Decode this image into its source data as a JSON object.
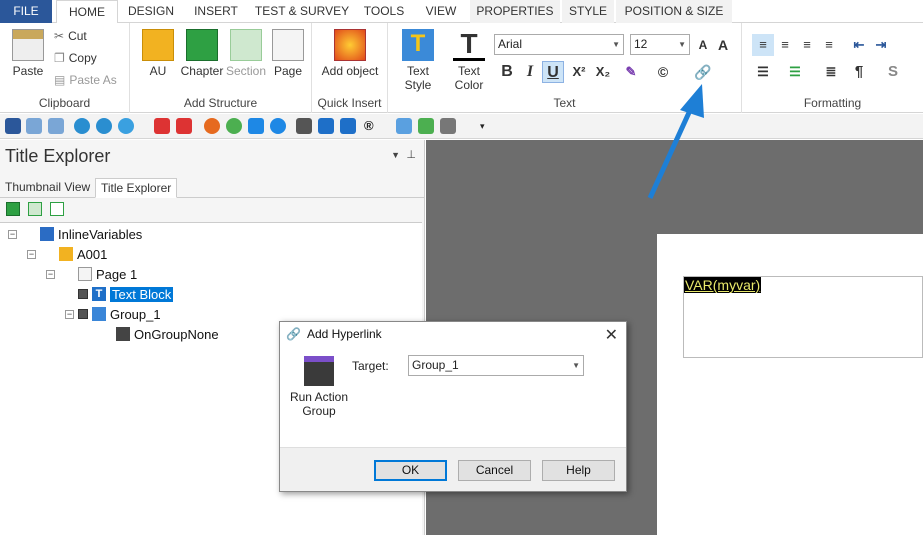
{
  "tabs": [
    "FILE",
    "HOME",
    "DESIGN",
    "INSERT",
    "TEST & SURVEY",
    "TOOLS",
    "VIEW",
    "PROPERTIES",
    "STYLE",
    "POSITION & SIZE"
  ],
  "ribbon": {
    "clipboard": {
      "label": "Clipboard",
      "paste": "Paste",
      "cut": "Cut",
      "copy": "Copy",
      "paste_as": "Paste As"
    },
    "structure": {
      "label": "Add Structure",
      "au": "AU",
      "chapter": "Chapter",
      "section": "Section",
      "page": "Page"
    },
    "quick": {
      "label": "Quick Insert",
      "add_object": "Add object"
    },
    "text": {
      "label": "Text",
      "text_style": "Text Style",
      "text_color": "Text Color",
      "font": "Arial",
      "size": "12"
    },
    "formatting": {
      "label": "Formatting"
    }
  },
  "explorer": {
    "title": "Title Explorer",
    "tab_thumb": "Thumbnail View",
    "tab_title": "Title Explorer",
    "tree": [
      "InlineVariables",
      "A001",
      "Page 1",
      "Text Block",
      "Group_1",
      "OnGroupNone"
    ]
  },
  "canvas": {
    "var_text": "VAR(myvar)"
  },
  "dialog": {
    "title": "Add Hyperlink",
    "action": "Run Action Group",
    "target_label": "Target:",
    "target_value": "Group_1",
    "ok": "OK",
    "cancel": "Cancel",
    "help": "Help"
  },
  "colors": {
    "file_tab": "#2b579a",
    "selection": "#0078d7",
    "arrow": "#1e7fd6"
  }
}
